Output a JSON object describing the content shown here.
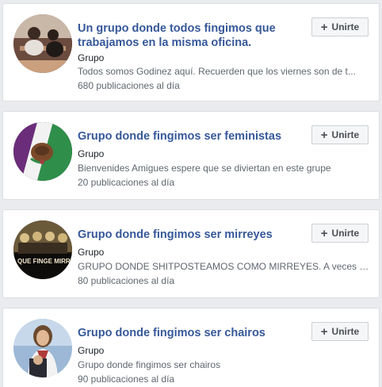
{
  "groups": [
    {
      "title": "Un grupo donde todos fingimos que trabajamos en la misma oficina.",
      "kind": "Grupo",
      "description": "Todos somos Godinez aquí. Recuerden que los viernes son de t...",
      "rate": "680 publicaciones al día",
      "join_label": "Unirte",
      "join_icon": "+"
    },
    {
      "title": "Grupo donde fingimos ser feministas",
      "kind": "Grupo",
      "description": "Bienvenides Amigues espere que se diviertan en este grupe",
      "rate": "20 publicaciones al día",
      "join_label": "Unirte",
      "join_icon": "+"
    },
    {
      "title": "Grupo donde fingimos ser mirreyes",
      "kind": "Grupo",
      "description": "GRUPO DONDE SHITPOSTEAMOS COMO MIRREYES. A veces fi...",
      "rate": "80 publicaciones al día",
      "join_label": "Unirte",
      "join_icon": "+",
      "avatar_text": "LO QUE FINGE MIRREY"
    },
    {
      "title": "Grupo donde fingimos ser chairos",
      "kind": "Grupo",
      "description": "Grupo donde fingimos ser chairos",
      "rate": "90 publicaciones al día",
      "join_label": "Unirte",
      "join_icon": "+"
    }
  ],
  "colors": {
    "link": "#365899",
    "text": "#1d2129",
    "secondary": "#606770",
    "background": "#e9ebee"
  }
}
